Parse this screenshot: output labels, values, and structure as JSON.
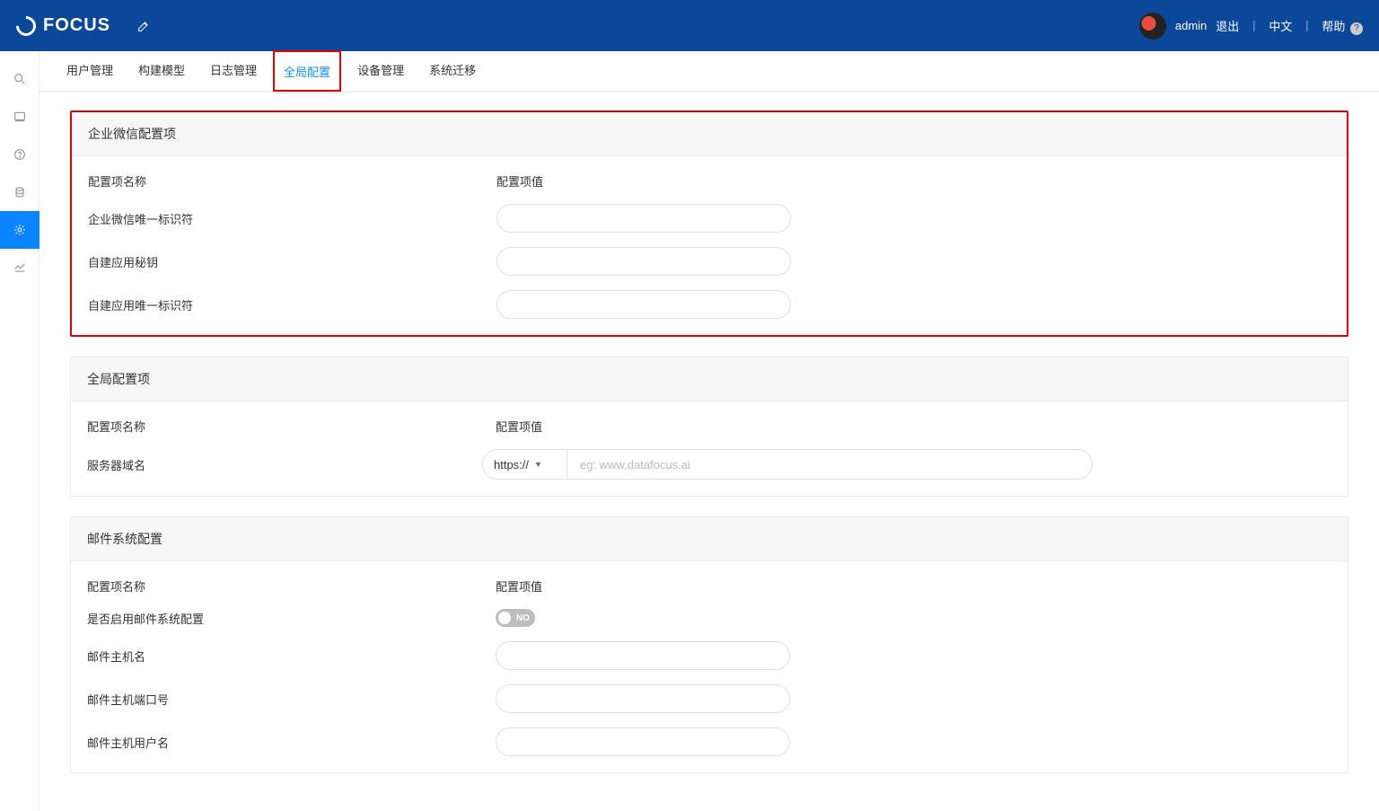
{
  "brand": {
    "name": "FOCUS"
  },
  "topbar": {
    "username": "admin",
    "logout": "退出",
    "language": "中文",
    "help": "帮助",
    "help_badge": "?"
  },
  "tabs": [
    {
      "key": "users",
      "label": "用户管理"
    },
    {
      "key": "model",
      "label": "构建模型"
    },
    {
      "key": "log",
      "label": "日志管理"
    },
    {
      "key": "global",
      "label": "全局配置",
      "active": true
    },
    {
      "key": "device",
      "label": "设备管理"
    },
    {
      "key": "migrate",
      "label": "系统迁移"
    }
  ],
  "sections": {
    "wecom": {
      "title": "企业微信配置项",
      "col_name": "配置项名称",
      "col_value": "配置项值",
      "rows": [
        {
          "label": "企业微信唯一标识符",
          "value": ""
        },
        {
          "label": "自建应用秘钥",
          "value": ""
        },
        {
          "label": "自建应用唯一标识符",
          "value": ""
        }
      ]
    },
    "global": {
      "title": "全局配置项",
      "col_name": "配置项名称",
      "col_value": "配置项值",
      "domain_label": "服务器域名",
      "protocol": "https://",
      "domain_placeholder": "eg: www.datafocus.ai"
    },
    "mail": {
      "title": "邮件系统配置",
      "col_name": "配置项名称",
      "col_value": "配置项值",
      "enable_label": "是否启用邮件系统配置",
      "toggle_state": "NO",
      "rows": [
        {
          "label": "邮件主机名",
          "value": ""
        },
        {
          "label": "邮件主机端口号",
          "value": ""
        },
        {
          "label": "邮件主机用户名",
          "value": ""
        }
      ]
    }
  }
}
